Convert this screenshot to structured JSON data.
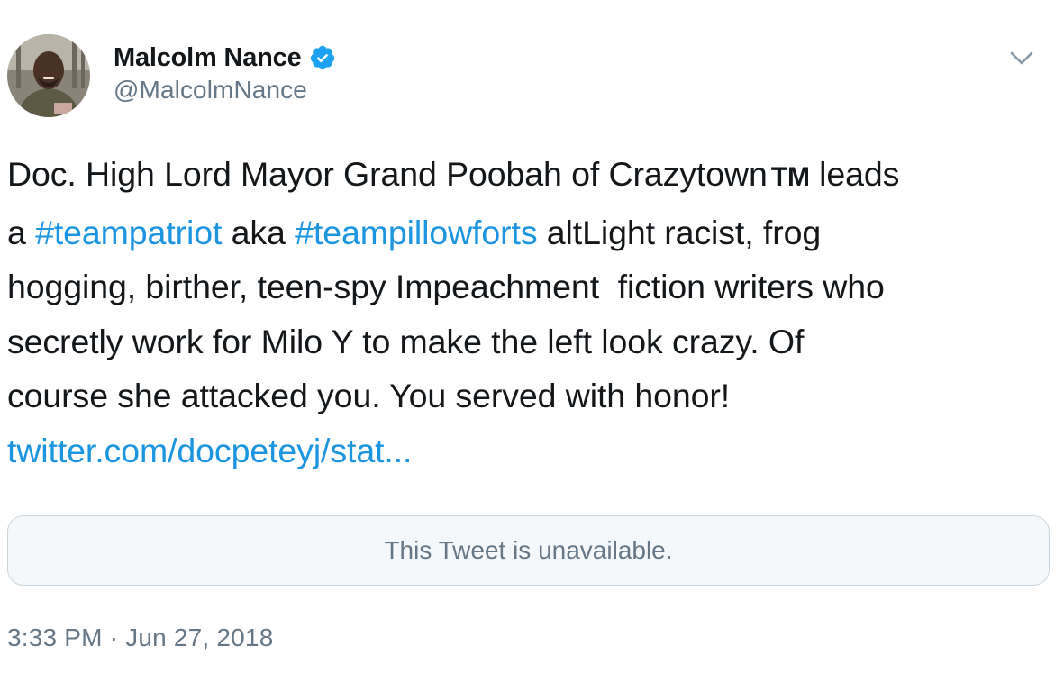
{
  "author": {
    "display_name": "Malcolm Nance",
    "handle": "@MalcolmNance",
    "verified": true
  },
  "tweet": {
    "line1_text": "Doc. High Lord Mayor Grand Poobah of Crazytown",
    "trademark": "TM",
    "line1_end": " leads",
    "line2_a": "a ",
    "hashtag1": "#teampatriot",
    "line2_b": " aka ",
    "hashtag2": "#teampillowforts",
    "line2_c": " altLight racist, frog",
    "line3": "hogging, birther, teen-spy Impeachment  fiction writers who",
    "line4": "secretly work for Milo Y to make the left look crazy. Of",
    "line5": "course she attacked you. You served with honor!",
    "link": "twitter.com/docpeteyj/stat..."
  },
  "quoted_tweet": {
    "message": "This Tweet is unavailable."
  },
  "timestamp": "3:33 PM · Jun 27, 2018",
  "colors": {
    "link": "#1b95e0",
    "verified": "#1da1f2",
    "secondary_text": "#657786"
  }
}
